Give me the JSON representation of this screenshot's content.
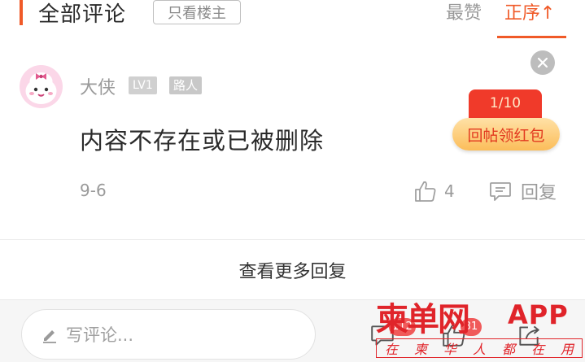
{
  "header": {
    "title": "全部评论",
    "filter_button": "只看楼主",
    "sort_hot": "最赞",
    "sort_order": "正序↑"
  },
  "comment": {
    "username": "大侠",
    "level": "LV1",
    "role": "路人",
    "content": "内容不存在或已被删除",
    "date": "9-6",
    "like_count": "4",
    "reply_label": "回复"
  },
  "promo": {
    "progress": "1/10",
    "label": "回帖领红包"
  },
  "more_replies": "查看更多回复",
  "bottom_bar": {
    "write_placeholder": "写评论...",
    "comment_badge": "112",
    "like_badge": "31"
  },
  "watermark": {
    "logo": "柬单网",
    "app": "APP",
    "slogan": [
      "在",
      "柬",
      "华",
      "人",
      "都",
      "在",
      "用"
    ]
  },
  "colors": {
    "accent": "#f05a28",
    "promo_red": "#f03a2a",
    "watermark_red": "#e0242a"
  }
}
